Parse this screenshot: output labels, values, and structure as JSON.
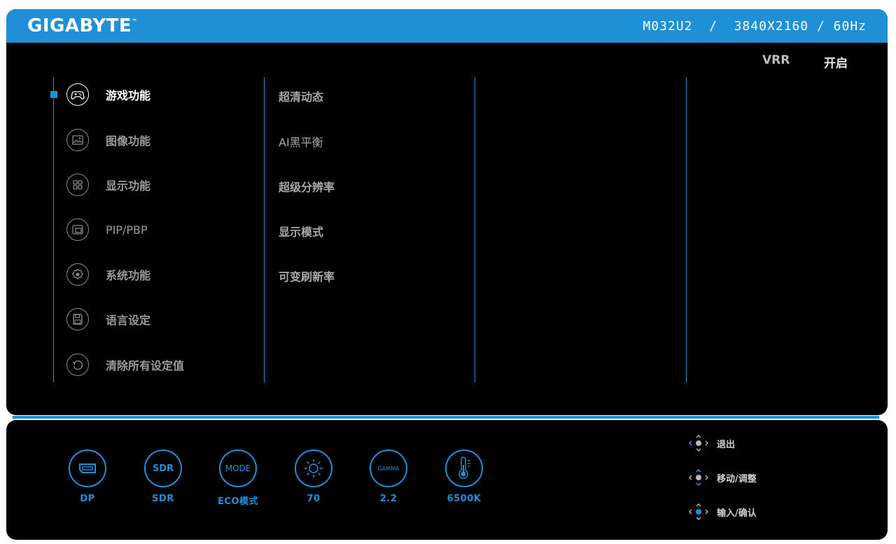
{
  "header": {
    "brand": "GIGABYTE",
    "trademark": "™",
    "model_info": "M032U2  /  3840X2160 / 60Hz"
  },
  "status": {
    "label": "VRR",
    "value": "开启"
  },
  "main_menu": {
    "items": [
      {
        "label": "游戏功能",
        "icon": "gamepad-icon",
        "active": true
      },
      {
        "label": "图像功能",
        "icon": "picture-icon"
      },
      {
        "label": "显示功能",
        "icon": "grid-icon"
      },
      {
        "label": "PIP/PBP",
        "icon": "pip-icon"
      },
      {
        "label": "系统功能",
        "icon": "gear-icon"
      },
      {
        "label": "语言设定",
        "icon": "save-icon"
      },
      {
        "label": "清除所有设定值",
        "icon": "reset-icon"
      }
    ]
  },
  "sub_menu": {
    "items": [
      "超清动态",
      "AI黑平衡",
      "超级分辨率",
      "显示模式",
      "可变刷新率"
    ]
  },
  "quick_status": {
    "items": [
      {
        "icon": "displayport-icon",
        "label": "DP"
      },
      {
        "icon": "sdr-icon",
        "icon_text": "SDR",
        "label": "SDR"
      },
      {
        "icon": "mode-icon",
        "icon_text": "MODE",
        "label": "ECO模式"
      },
      {
        "icon": "brightness-icon",
        "label": "70"
      },
      {
        "icon": "gamma-icon",
        "icon_text": "GAMMA",
        "label": "2.2"
      },
      {
        "icon": "thermometer-icon",
        "label": "6500K"
      }
    ]
  },
  "hints": {
    "items": [
      {
        "icon": "joystick-exit-icon",
        "label": "退出"
      },
      {
        "icon": "joystick-move-icon",
        "label": "移动/调整"
      },
      {
        "icon": "joystick-enter-icon",
        "label": "输入/确认"
      }
    ]
  },
  "colors": {
    "accent": "#1f90d7",
    "background": "#000000",
    "text_active": "#ffffff",
    "text_inactive": "#9a9a9a"
  }
}
